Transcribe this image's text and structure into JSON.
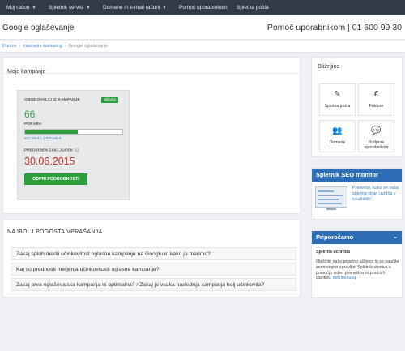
{
  "topnav": {
    "items": [
      {
        "label": "Moj račun",
        "caret": true
      },
      {
        "label": "Spletnik servisi",
        "caret": true
      },
      {
        "label": "Domene in e-mail računi",
        "caret": true
      },
      {
        "label": "Pomoč uporabnikom",
        "caret": false
      },
      {
        "label": "Spletna pošta",
        "caret": false
      }
    ]
  },
  "header": {
    "title": "Google oglaševanje",
    "help": "Pomoč uporabnikom | 01 600 99 30"
  },
  "breadcrumb": [
    "Domov",
    "Internetni marketing",
    "Google oglaševanje"
  ],
  "campaigns": {
    "title": "Moje kampanje",
    "card": {
      "visitors_label": "OBISKOVALCI IZ KAMPANJE",
      "status": "aktivno",
      "visitors": "66",
      "usage_label": "PORABA",
      "usage_fraction": 0.545,
      "budget": "817,79 € / 1.500,00 €",
      "end_label": "PREDVIDEN ZAKLJUČEK",
      "end_help": "?",
      "end_date": "30.06.2015",
      "details_button": "ODPRI PODROBNOSTI"
    }
  },
  "faq": {
    "title": "NAJBOLJ POGOSTA VPRAŠANJA",
    "items": [
      "Zakaj sploh meriti učinkovitost oglasne kampanje na Googlu in kako jo merimo?",
      "Kaj so prednosti merjenja učinkovitosti oglasne kampanje?",
      "Zakaj prva oglaševalska kampanja ni optimalna? / Zakaj je vsaka naslednja kampanja bolj učinkovita?"
    ]
  },
  "shortcuts": {
    "title": "Bližnjice",
    "items": [
      {
        "label": "Spletna pošta",
        "icon": "edit-icon"
      },
      {
        "label": "Fakture",
        "icon": "euro-icon"
      },
      {
        "label": "Domene",
        "icon": "users-icon"
      },
      {
        "label": "Podpora uporabnikom",
        "icon": "chat-icon"
      }
    ]
  },
  "seo": {
    "title": "Spletnik SEO monitor",
    "text": "Preverite, kako se vaša spletna stran uvršča v iskalnikih!"
  },
  "recommend": {
    "title": "Priporočamo",
    "subtitle": "Spletna učilnica",
    "text": "Obiščite našo prijazno učilnico in se naučite samostojno upravljati Spletnik storitve s pomočjo video posnetkov in poučnih člankov.",
    "link": "Kliknite tukaj"
  },
  "colors": {
    "nav_bg": "#323b46",
    "accent_green": "#2e9d3c",
    "date_red": "#c23a2a",
    "link_blue": "#3a7fc1",
    "header_blue": "#2d6db5"
  }
}
